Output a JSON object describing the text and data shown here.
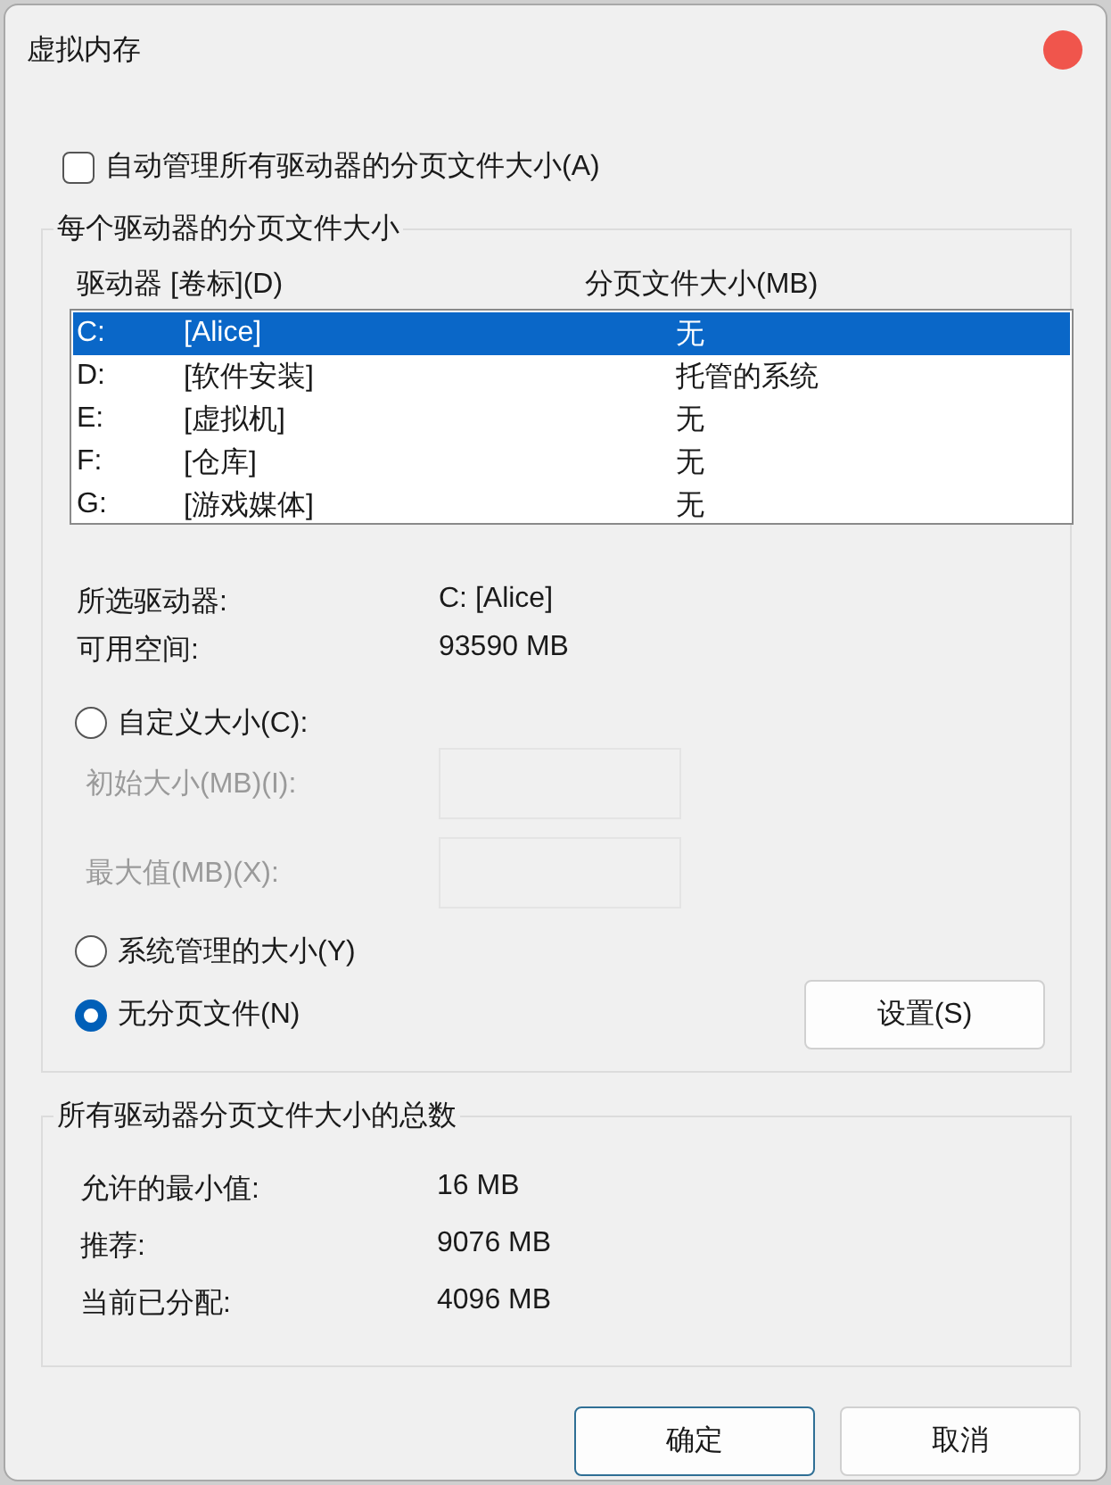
{
  "window": {
    "title": "虚拟内存"
  },
  "auto_manage": {
    "label": "自动管理所有驱动器的分页文件大小(A)",
    "checked": false
  },
  "per_drive": {
    "title": "每个驱动器的分页文件大小",
    "columns": [
      "驱动器 [卷标](D)",
      "分页文件大小(MB)"
    ],
    "drives": [
      {
        "letter": "C:",
        "label": "[Alice]",
        "size": "无",
        "selected": true
      },
      {
        "letter": "D:",
        "label": "[软件安装]",
        "size": "托管的系统",
        "selected": false
      },
      {
        "letter": "E:",
        "label": "[虚拟机]",
        "size": "无",
        "selected": false
      },
      {
        "letter": "F:",
        "label": "[仓库]",
        "size": "无",
        "selected": false
      },
      {
        "letter": "G:",
        "label": "[游戏媒体]",
        "size": "无",
        "selected": false
      }
    ],
    "info": [
      {
        "label": "所选驱动器:",
        "value": "C:  [Alice]"
      },
      {
        "label": "可用空间:",
        "value": "93590 MB"
      }
    ],
    "options": [
      {
        "label": "自定义大小(C):",
        "selected": false
      },
      {
        "label": "系统管理的大小(Y)",
        "selected": false
      },
      {
        "label": "无分页文件(N)",
        "selected": true
      }
    ],
    "fields": [
      {
        "label": "初始大小(MB)(I):",
        "disabled": true
      },
      {
        "label": "最大值(MB)(X):",
        "disabled": true
      }
    ],
    "set_button": "设置(S)"
  },
  "totals": {
    "title": "所有驱动器分页文件大小的总数",
    "rows": [
      {
        "label": "允许的最小值:",
        "value": "16 MB"
      },
      {
        "label": "推荐:",
        "value": "9076 MB"
      },
      {
        "label": "当前已分配:",
        "value": "4096 MB"
      }
    ]
  },
  "buttons": [
    {
      "label": "确定",
      "default": true
    },
    {
      "label": "取消",
      "default": false
    }
  ]
}
